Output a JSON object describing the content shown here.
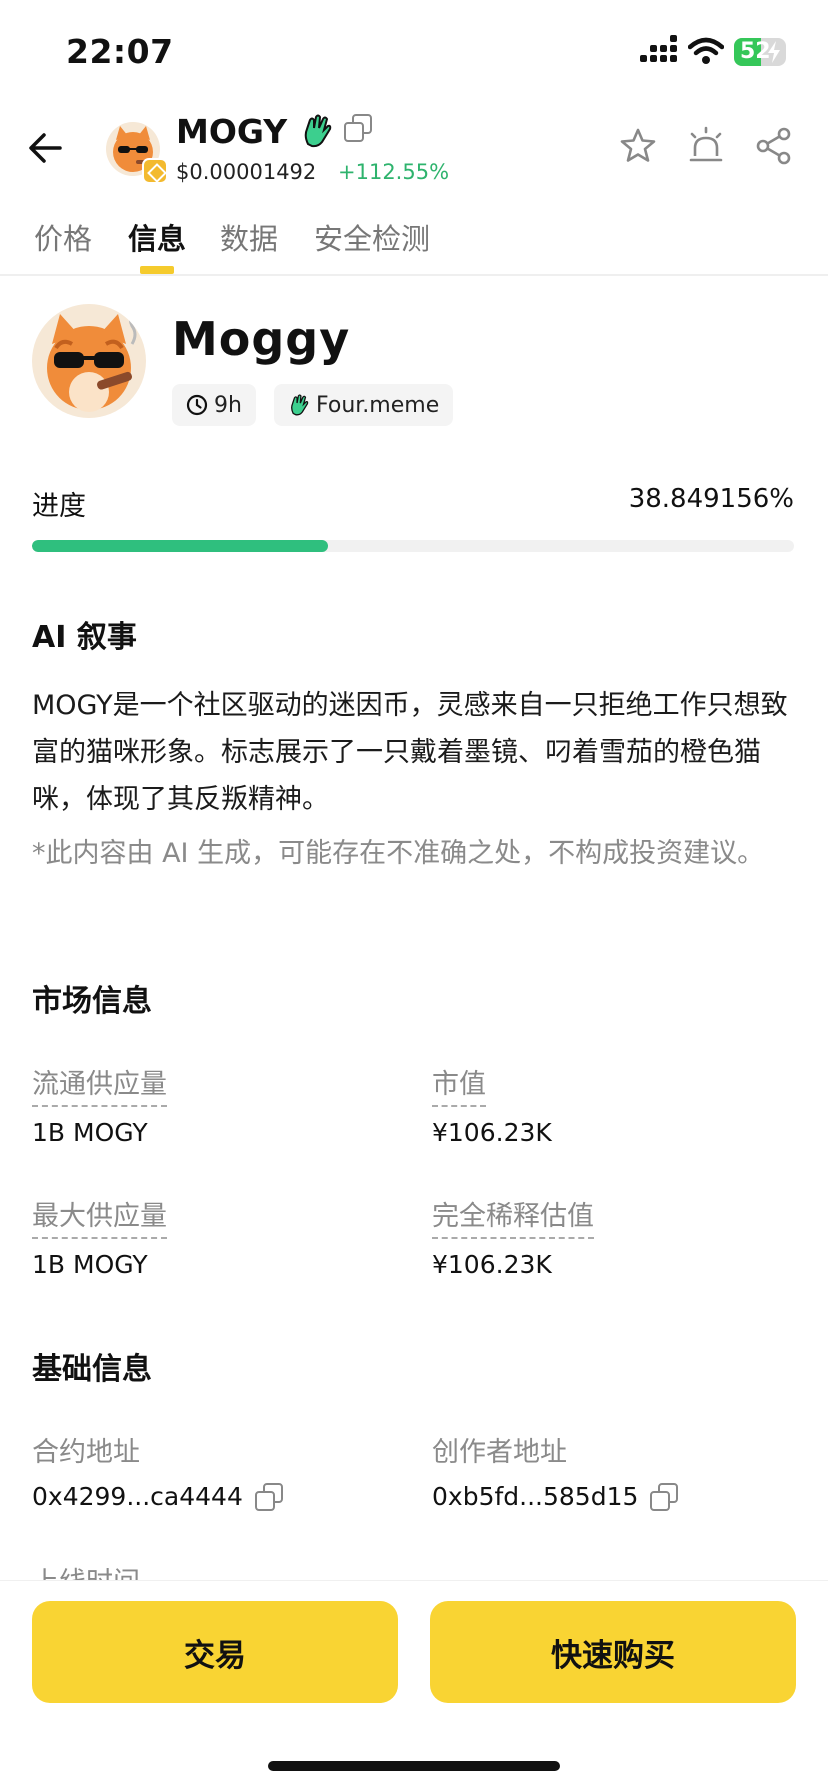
{
  "status_bar": {
    "time": "22:07",
    "battery_level": 52,
    "battery_text": "52"
  },
  "header": {
    "symbol": "MOGY",
    "price": "$0.00001492",
    "change": "+112.55%",
    "icons": [
      "back-arrow-icon",
      "star-icon",
      "alarm-icon",
      "share-icon",
      "copy-icon"
    ]
  },
  "tabs": [
    {
      "label": "价格",
      "active": false
    },
    {
      "label": "信息",
      "active": true
    },
    {
      "label": "数据",
      "active": false
    },
    {
      "label": "安全检测",
      "active": false
    }
  ],
  "profile": {
    "name": "Moggy",
    "age": "9h",
    "platform": "Four.meme"
  },
  "progress": {
    "label": "进度",
    "value_text": "38.849156%",
    "value": 0.38849156
  },
  "ai_narrative": {
    "title": "AI 叙事",
    "text": "MOGY是一个社区驱动的迷因币，灵感来自一只拒绝工作只想致富的猫咪形象。标志展示了一只戴着墨镜、叼着雪茄的橙色猫咪，体现了其反叛精神。",
    "disclaimer": "*此内容由 AI 生成，可能存在不准确之处，不构成投资建议。"
  },
  "market_info": {
    "title": "市场信息",
    "circulating_label": "流通供应量",
    "circulating_value": "1B MOGY",
    "market_cap_label": "市值",
    "market_cap_value": "¥106.23K",
    "max_supply_label": "最大供应量",
    "max_supply_value": "1B MOGY",
    "fdv_label": "完全稀释估值",
    "fdv_value": "¥106.23K"
  },
  "basic_info": {
    "title": "基础信息",
    "contract_label": "合约地址",
    "contract_value": "0x4299...ca4444",
    "creator_label": "创作者地址",
    "creator_value": "0xb5fd...585d15",
    "listing_label": "上线时间"
  },
  "actions": {
    "trade": "交易",
    "quick_buy": "快速购买"
  },
  "colors": {
    "accent": "#f9d433",
    "positive": "#2eb36d",
    "progress": "#2fbf7e"
  }
}
